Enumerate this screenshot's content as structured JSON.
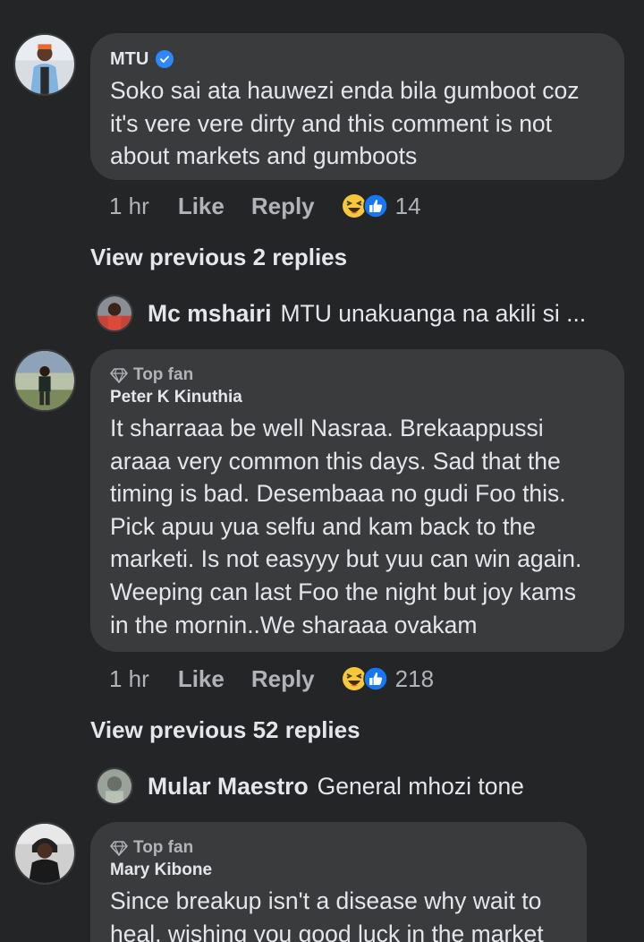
{
  "comments": [
    {
      "author": "MTU",
      "verified": true,
      "text": "Soko sai ata hauwezi enda bila gumboot coz\nit's vere vere dirty and this comment is not\nabout markets and gumboots",
      "time": "1 hr",
      "like_label": "Like",
      "reply_label": "Reply",
      "reaction_count": "14"
    },
    {
      "badge": "Top fan",
      "author": "Peter K Kinuthia",
      "text": "It sharraaa be well Nasraa. Brekaappussi\naraaa very common this days. Sad that the\ntiming is bad. Desembaaa no gudi Foo this.\nPick apuu yua selfu and kam back to the\nmarketi. Is not easyyy but yuu can win again.\nWeeping can last Foo the night but joy kams\nin the mornin..We sharaaa ovakam",
      "time": "1 hr",
      "like_label": "Like",
      "reply_label": "Reply",
      "reaction_count": "218"
    },
    {
      "badge": "Top fan",
      "author": "Mary Kibone",
      "text": "Since breakup isn't a disease why wait to\nheal, wishing you good luck in the market"
    }
  ],
  "view_previous": [
    "View previous 2 replies",
    "View previous 52 replies"
  ],
  "replies": [
    {
      "author": "Mc mshairi",
      "text": "MTU unakuanga na akili si ..."
    },
    {
      "author": "Mular Maestro",
      "text": "General mhozi tone"
    }
  ],
  "icons": {
    "verified": "verified-badge-icon",
    "top_fan": "diamond-icon",
    "reaction_haha": "haha-emoji-icon",
    "reaction_like": "thumbs-up-icon"
  },
  "colors": {
    "background": "#242526",
    "bubble": "#3a3b3c",
    "primary_text": "#e4e6eb",
    "secondary_text": "#b0b3b8",
    "accent_blue": "#2d88ff"
  }
}
